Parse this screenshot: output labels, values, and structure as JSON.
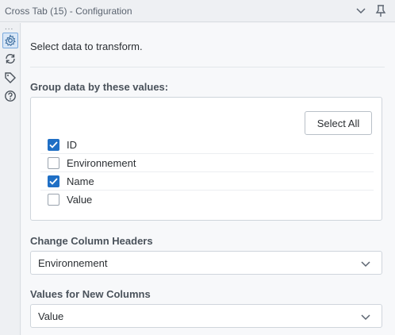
{
  "header": {
    "title": "Cross Tab (15) - Configuration",
    "icons": [
      "chevron-down-icon",
      "pin-icon"
    ]
  },
  "rail": {
    "dots": "...",
    "icons": [
      "gear-icon",
      "refresh-icon",
      "tag-icon",
      "help-icon"
    ]
  },
  "main": {
    "intro": "Select data to transform.",
    "group_label": "Group data by these values:",
    "select_all_label": "Select All",
    "fields": [
      {
        "label": "ID",
        "checked": true
      },
      {
        "label": "Environnement",
        "checked": false
      },
      {
        "label": "Name",
        "checked": true
      },
      {
        "label": "Value",
        "checked": false
      }
    ],
    "headers_label": "Change Column Headers",
    "headers_value": "Environnement",
    "values_label": "Values for New Columns",
    "values_value": "Value"
  },
  "colors": {
    "accent": "#1f6fc5",
    "panel_bg": "#f7f8fa",
    "border": "#cfd5dc"
  }
}
